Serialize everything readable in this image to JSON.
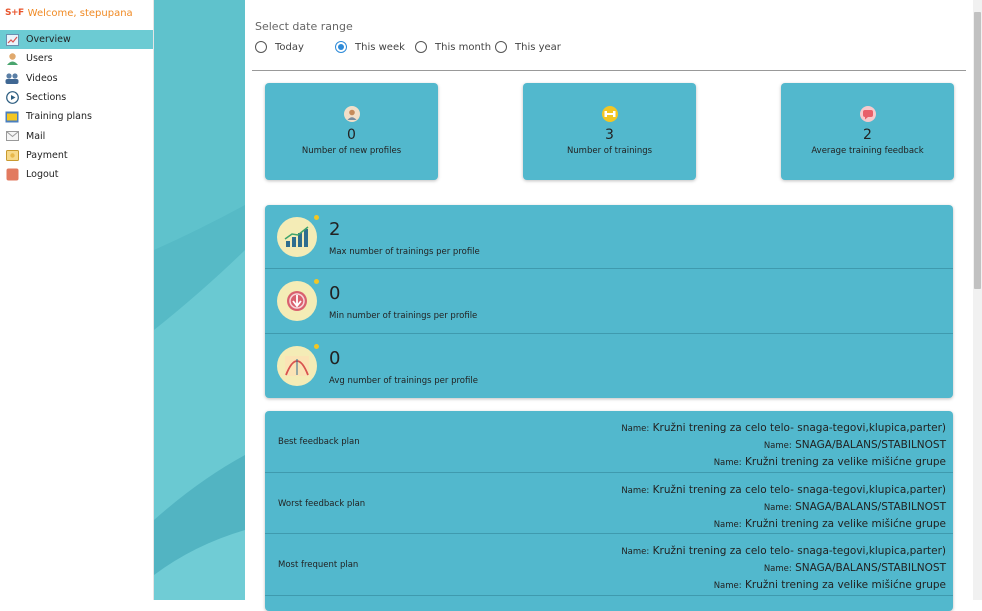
{
  "sidebar": {
    "logo_text": "S+F",
    "welcome": "Welcome, stepupana",
    "items": [
      {
        "label": "Overview",
        "icon": "chart-icon",
        "color": "#7fb3d5"
      },
      {
        "label": "Users",
        "icon": "user-icon",
        "color": "#e0a96d"
      },
      {
        "label": "Videos",
        "icon": "users-group-icon",
        "color": "#5b7fa6"
      },
      {
        "label": "Sections",
        "icon": "play-circle-icon",
        "color": "#2c5d80"
      },
      {
        "label": "Training plans",
        "icon": "presentation-icon",
        "color": "#4a7fbf"
      },
      {
        "label": "Mail",
        "icon": "mail-icon",
        "color": "#999999"
      },
      {
        "label": "Payment",
        "icon": "wallet-icon",
        "color": "#e8b84a"
      },
      {
        "label": "Logout",
        "icon": "logout-icon",
        "color": "#e27a5f"
      }
    ]
  },
  "filter": {
    "label": "Select date range",
    "options": [
      "Today",
      "This week",
      "This month",
      "This year"
    ],
    "selected": "This week"
  },
  "cards": [
    {
      "value": "0",
      "label": "Number of new profiles",
      "icon": "avatar-icon"
    },
    {
      "value": "3",
      "label": "Number of trainings",
      "icon": "dumbbell-icon"
    },
    {
      "value": "2",
      "label": "Average training feedback",
      "icon": "feedback-icon"
    }
  ],
  "stats": [
    {
      "value": "2",
      "label": "Max number of trainings per profile",
      "icon": "bar-growth-icon"
    },
    {
      "value": "0",
      "label": "Min number of trainings per profile",
      "icon": "down-arrow-icon"
    },
    {
      "value": "0",
      "label": "Avg number of trainings per profile",
      "icon": "bell-curve-icon"
    }
  ],
  "plans": {
    "name_prefix": "Name:",
    "rows": [
      {
        "title": "Best feedback plan",
        "names": [
          "Kružni trening za celo telo- snaga-tegovi,klupica,parter)",
          "SNAGA/BALANS/STABILNOST",
          "Kružni trening za velike mišićne grupe"
        ]
      },
      {
        "title": "Worst feedback plan",
        "names": [
          "Kružni trening za celo telo- snaga-tegovi,klupica,parter)",
          "SNAGA/BALANS/STABILNOST",
          "Kružni trening za velike mišićne grupe"
        ]
      },
      {
        "title": "Most frequent plan",
        "names": [
          "Kružni trening za celo telo- snaga-tegovi,klupica,parter)",
          "SNAGA/BALANS/STABILNOST",
          "Kružni trening za velike mišićne grupe"
        ]
      }
    ]
  }
}
